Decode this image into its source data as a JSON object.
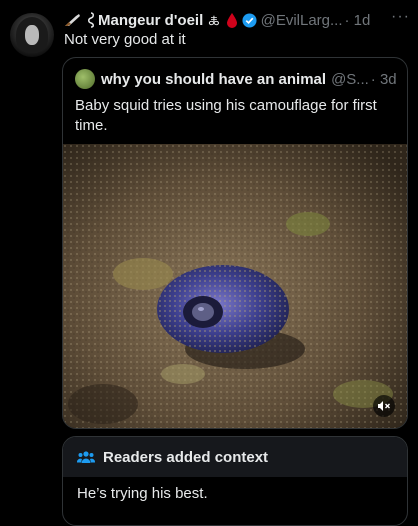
{
  "post": {
    "display_name": "Mangeur d'oeil",
    "name_emoji": "🜏",
    "handle": "@EvilLarg...",
    "time": "· 1d",
    "more": "···",
    "text": "Not very good at it"
  },
  "quoted": {
    "display_name": "why you should have an animal",
    "handle": "@S...",
    "time": "· 3d",
    "text": "Baby squid tries using his camouflage for first time."
  },
  "context": {
    "title": "Readers added context",
    "text": "He’s trying his best."
  },
  "colors": {
    "background": "#000000",
    "text": "#e7e9ea",
    "muted": "#71767b",
    "verified": "#1d9bf0",
    "community_notes": "#1d9bf0",
    "border": "#2f3336"
  },
  "icons": [
    "avatar",
    "knife-icon",
    "pin-icon",
    "blood-drop-icon",
    "verified-badge-icon",
    "more-icon",
    "mute-icon",
    "readers-icon"
  ]
}
